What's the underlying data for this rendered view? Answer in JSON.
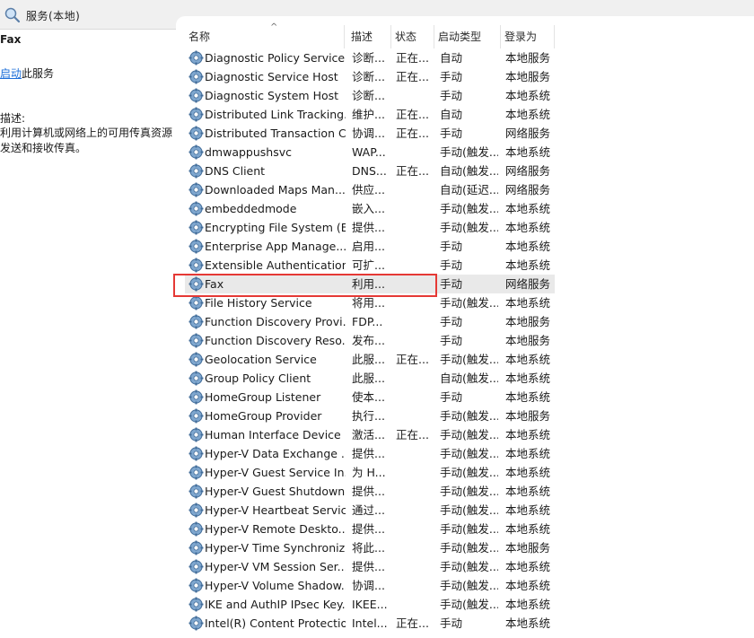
{
  "window": {
    "title": "服务(本地)",
    "icon": "search-icon"
  },
  "left_pane": {
    "service_name": "Fax",
    "action_link": "启动",
    "action_suffix": "此服务",
    "description_label": "描述:",
    "description_text": "利用计算机或网络上的可用传真资源发送和接收传真。"
  },
  "columns": [
    "名称",
    "描述",
    "状态",
    "启动类型",
    "登录为"
  ],
  "selected_index": 12,
  "rows": [
    {
      "name": "Diagnostic Policy Service",
      "desc": "诊断...",
      "status": "正在...",
      "startup": "自动",
      "logon": "本地服务"
    },
    {
      "name": "Diagnostic Service Host",
      "desc": "诊断...",
      "status": "正在...",
      "startup": "手动",
      "logon": "本地服务"
    },
    {
      "name": "Diagnostic System Host",
      "desc": "诊断...",
      "status": "",
      "startup": "手动",
      "logon": "本地系统"
    },
    {
      "name": "Distributed Link Tracking...",
      "desc": "维护...",
      "status": "正在...",
      "startup": "自动",
      "logon": "本地系统"
    },
    {
      "name": "Distributed Transaction C...",
      "desc": "协调...",
      "status": "正在...",
      "startup": "手动",
      "logon": "网络服务"
    },
    {
      "name": "dmwappushsvc",
      "desc": "WAP...",
      "status": "",
      "startup": "手动(触发...",
      "logon": "本地系统"
    },
    {
      "name": "DNS Client",
      "desc": "DNS...",
      "status": "正在...",
      "startup": "自动(触发...",
      "logon": "网络服务"
    },
    {
      "name": "Downloaded Maps Man...",
      "desc": "供应...",
      "status": "",
      "startup": "自动(延迟...",
      "logon": "网络服务"
    },
    {
      "name": "embeddedmode",
      "desc": "嵌入...",
      "status": "",
      "startup": "手动(触发...",
      "logon": "本地系统"
    },
    {
      "name": "Encrypting File System (E...",
      "desc": "提供...",
      "status": "",
      "startup": "手动(触发...",
      "logon": "本地系统"
    },
    {
      "name": "Enterprise App Manage...",
      "desc": "启用...",
      "status": "",
      "startup": "手动",
      "logon": "本地系统"
    },
    {
      "name": "Extensible Authentication...",
      "desc": "可扩...",
      "status": "",
      "startup": "手动",
      "logon": "本地系统"
    },
    {
      "name": "Fax",
      "desc": "利用...",
      "status": "",
      "startup": "手动",
      "logon": "网络服务"
    },
    {
      "name": "File History Service",
      "desc": "将用...",
      "status": "",
      "startup": "手动(触发...",
      "logon": "本地系统"
    },
    {
      "name": "Function Discovery Provi...",
      "desc": "FDP...",
      "status": "",
      "startup": "手动",
      "logon": "本地服务"
    },
    {
      "name": "Function Discovery Reso...",
      "desc": "发布...",
      "status": "",
      "startup": "手动",
      "logon": "本地服务"
    },
    {
      "name": "Geolocation Service",
      "desc": "此服...",
      "status": "正在...",
      "startup": "手动(触发...",
      "logon": "本地系统"
    },
    {
      "name": "Group Policy Client",
      "desc": "此服...",
      "status": "",
      "startup": "自动(触发...",
      "logon": "本地系统"
    },
    {
      "name": "HomeGroup Listener",
      "desc": "使本...",
      "status": "",
      "startup": "手动",
      "logon": "本地系统"
    },
    {
      "name": "HomeGroup Provider",
      "desc": "执行...",
      "status": "",
      "startup": "手动(触发...",
      "logon": "本地服务"
    },
    {
      "name": "Human Interface Device ...",
      "desc": "激活...",
      "status": "正在...",
      "startup": "手动(触发...",
      "logon": "本地系统"
    },
    {
      "name": "Hyper-V Data Exchange ...",
      "desc": "提供...",
      "status": "",
      "startup": "手动(触发...",
      "logon": "本地系统"
    },
    {
      "name": "Hyper-V Guest Service In...",
      "desc": "为 H...",
      "status": "",
      "startup": "手动(触发...",
      "logon": "本地系统"
    },
    {
      "name": "Hyper-V Guest Shutdown...",
      "desc": "提供...",
      "status": "",
      "startup": "手动(触发...",
      "logon": "本地系统"
    },
    {
      "name": "Hyper-V Heartbeat Service",
      "desc": "通过...",
      "status": "",
      "startup": "手动(触发...",
      "logon": "本地系统"
    },
    {
      "name": "Hyper-V Remote Deskto...",
      "desc": "提供...",
      "status": "",
      "startup": "手动(触发...",
      "logon": "本地系统"
    },
    {
      "name": "Hyper-V Time Synchroniz...",
      "desc": "将此...",
      "status": "",
      "startup": "手动(触发...",
      "logon": "本地服务"
    },
    {
      "name": "Hyper-V VM Session Ser...",
      "desc": "提供...",
      "status": "",
      "startup": "手动(触发...",
      "logon": "本地系统"
    },
    {
      "name": "Hyper-V Volume Shadow...",
      "desc": "协调...",
      "status": "",
      "startup": "手动(触发...",
      "logon": "本地系统"
    },
    {
      "name": "IKE and AuthIP IPsec Key...",
      "desc": "IKEE...",
      "status": "",
      "startup": "手动(触发...",
      "logon": "本地系统"
    },
    {
      "name": "Intel(R) Content Protectio...",
      "desc": "Intel...",
      "status": "正在...",
      "startup": "手动",
      "logon": "本地系统"
    }
  ]
}
